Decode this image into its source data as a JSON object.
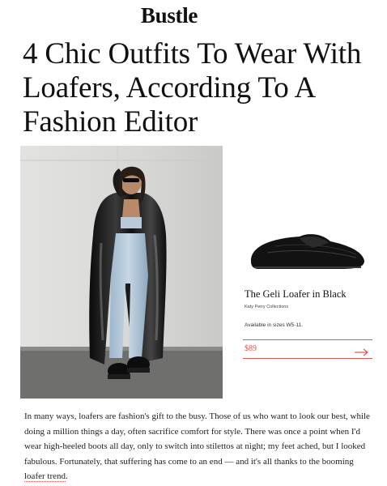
{
  "header": {
    "logo": "Bustle"
  },
  "article": {
    "headline": "4 Chic Outfits To Wear With Loafers, According To A Fashion Editor",
    "body_before_link": "In many ways, loafers are fashion's gift to the busy. Those of us who want to look our best, while doing a million things a day, often sacrifice comfort for style. There was once a point when I'd wear high-heeled boots all day, only to switch into stilettos at night; my feet ached, but I looked fabulous. Fortunately, that suffering has come to an end — and it's all thanks to the booming ",
    "body_link": "loafer trend",
    "body_after_link": "."
  },
  "product": {
    "name": "The Geli Loafer in Black",
    "brand": "Katy Perry Collections",
    "sizes": "Available in sizes W5-11.",
    "price": "$89",
    "icons": {
      "arrow": "arrow-right-icon"
    }
  },
  "colors": {
    "accent": "#d9554e",
    "text": "#111111"
  }
}
